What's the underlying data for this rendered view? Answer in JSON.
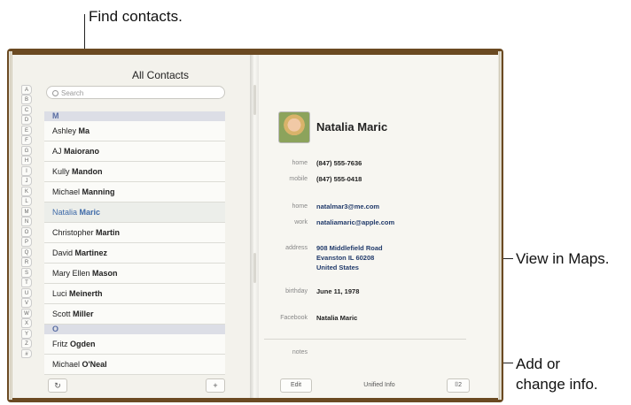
{
  "callouts": {
    "find_contacts": "Find contacts.",
    "view_in_maps": "View in Maps.",
    "add_or": "Add or",
    "change_info": "change info."
  },
  "list": {
    "title": "All Contacts",
    "search_placeholder": "Search",
    "index_letters": [
      "A",
      "B",
      "C",
      "D",
      "E",
      "F",
      "G",
      "H",
      "I",
      "J",
      "K",
      "L",
      "M",
      "N",
      "O",
      "P",
      "Q",
      "R",
      "S",
      "T",
      "U",
      "V",
      "W",
      "X",
      "Y",
      "Z",
      "#"
    ],
    "section_m": "M",
    "section_o": "O",
    "contacts": [
      {
        "first": "Ashley ",
        "last": "Ma"
      },
      {
        "first": "AJ ",
        "last": "Maiorano"
      },
      {
        "first": "Kully ",
        "last": "Mandon"
      },
      {
        "first": "Michael ",
        "last": "Manning"
      },
      {
        "first": "Natalia ",
        "last": "Maric"
      },
      {
        "first": "Christopher ",
        "last": "Martin"
      },
      {
        "first": "David ",
        "last": "Martinez"
      },
      {
        "first": "Mary Ellen ",
        "last": "Mason"
      },
      {
        "first": "Luci ",
        "last": "Meinerth"
      },
      {
        "first": "Scott ",
        "last": "Miller"
      }
    ],
    "contacts_o": [
      {
        "first": "Fritz ",
        "last": "Ogden"
      },
      {
        "first": "Michael ",
        "last": "O'Neal"
      }
    ],
    "refresh_icon": "↻",
    "add_icon": "+"
  },
  "detail": {
    "name": "Natalia Maric",
    "phone_home_label": "home",
    "phone_home": "(847) 555-7636",
    "phone_mobile_label": "mobile",
    "phone_mobile": "(847) 555-0418",
    "email_home_label": "home",
    "email_home": "natalmar3@me.com",
    "email_work_label": "work",
    "email_work": "nataliamaric@apple.com",
    "address_label": "address",
    "address_line1": "908 Middlefield Road",
    "address_line2": "Evanston IL 60208",
    "address_line3": "United States",
    "birthday_label": "birthday",
    "birthday": "June 11, 1978",
    "facebook_label": "Facebook",
    "facebook": "Natalia Maric",
    "notes_label": "notes",
    "edit_label": "Edit",
    "unified_info": "Unified Info",
    "linked_count": "⌷2"
  },
  "colors": {
    "selected_text": "#3e6aa8",
    "section_bg": "#dcdee6",
    "book_cover": "#6b4a22"
  }
}
